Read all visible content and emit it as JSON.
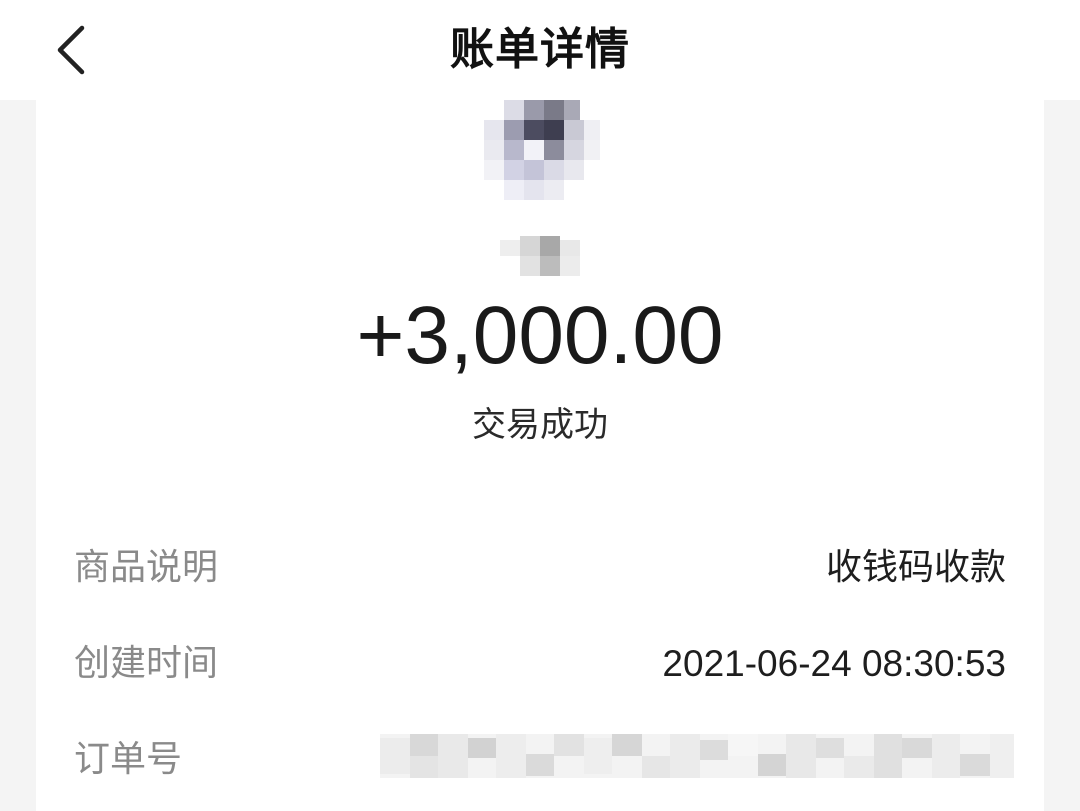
{
  "header": {
    "title": "账单详情",
    "back_icon": "chevron-left-icon"
  },
  "transaction": {
    "avatar": "blurred-avatar",
    "payer_name": "",
    "amount": "+3,000.00",
    "status": "交易成功"
  },
  "details": [
    {
      "label": "商品说明",
      "value": "收钱码收款"
    },
    {
      "label": "创建时间",
      "value": "2021-06-24 08:30:53"
    },
    {
      "label": "订单号",
      "value": ""
    }
  ],
  "colors": {
    "background": "#f4f4f4",
    "card": "#ffffff",
    "label": "#8a8a8a",
    "value": "#1e1e1e"
  }
}
